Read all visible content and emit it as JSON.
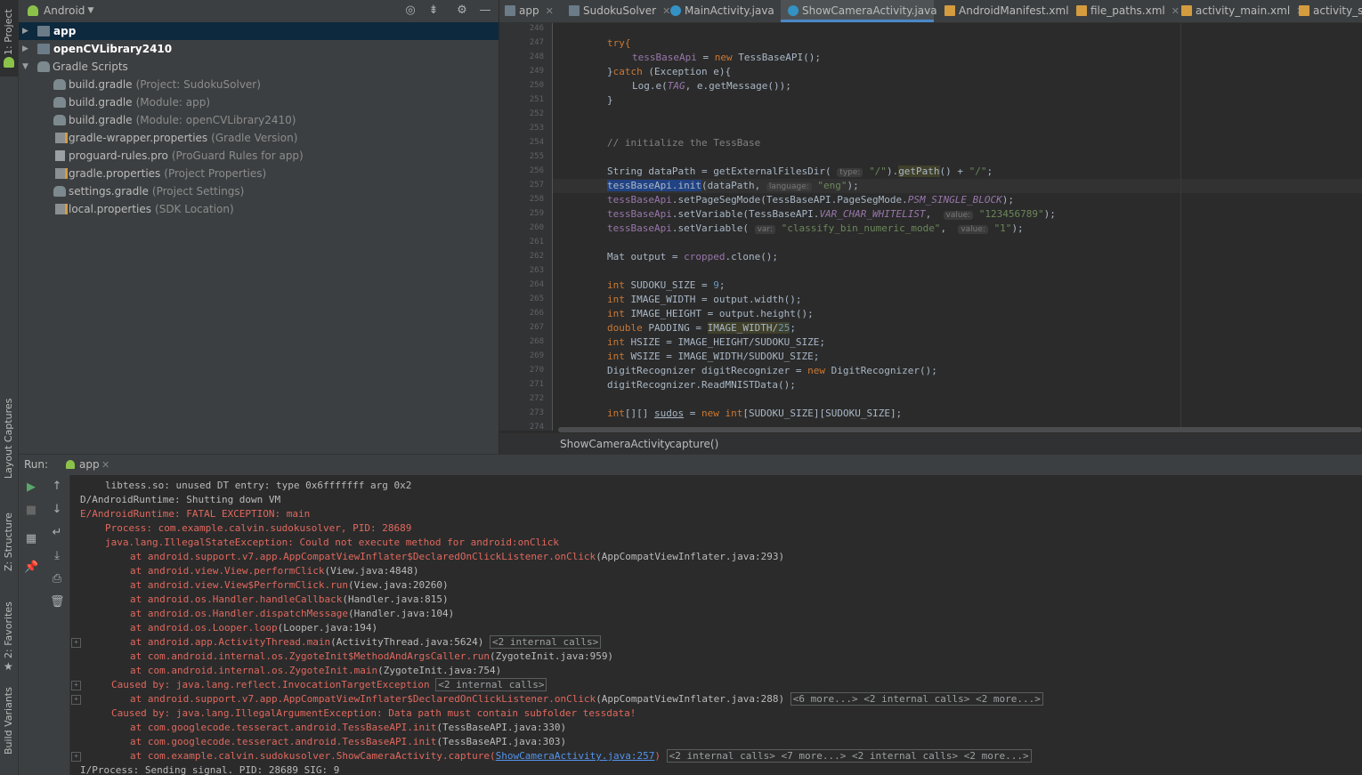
{
  "left_strip": {
    "tabs": [
      {
        "label": "1: Project"
      },
      {
        "label": "Layout Captures"
      },
      {
        "label": "Z: Structure"
      },
      {
        "label": "2: Favorites"
      },
      {
        "label": "Build Variants"
      }
    ]
  },
  "project": {
    "view_mode": "Android",
    "tree": [
      {
        "name": "app",
        "hint": ""
      },
      {
        "name": "openCVLibrary2410",
        "hint": ""
      },
      {
        "name": "Gradle Scripts",
        "hint": ""
      },
      {
        "name": "build.gradle",
        "hint": "(Project: SudokuSolver)"
      },
      {
        "name": "build.gradle",
        "hint": "(Module: app)"
      },
      {
        "name": "build.gradle",
        "hint": "(Module: openCVLibrary2410)"
      },
      {
        "name": "gradle-wrapper.properties",
        "hint": "(Gradle Version)"
      },
      {
        "name": "proguard-rules.pro",
        "hint": "(ProGuard Rules for app)"
      },
      {
        "name": "gradle.properties",
        "hint": "(Project Properties)"
      },
      {
        "name": "settings.gradle",
        "hint": "(Project Settings)"
      },
      {
        "name": "local.properties",
        "hint": "(SDK Location)"
      }
    ]
  },
  "editor": {
    "tabs": [
      {
        "label": "app"
      },
      {
        "label": "SudokuSolver"
      },
      {
        "label": "MainActivity.java"
      },
      {
        "label": "ShowCameraActivity.java"
      },
      {
        "label": "AndroidManifest.xml"
      },
      {
        "label": "file_paths.xml"
      },
      {
        "label": "activity_main.xml"
      },
      {
        "label": "activity_sho"
      }
    ],
    "line_numbers": [
      "246",
      "247",
      "248",
      "249",
      "250",
      "251",
      "252",
      "253",
      "254",
      "255",
      "256",
      "257",
      "258",
      "259",
      "260",
      "261",
      "262",
      "263",
      "264",
      "265",
      "266",
      "267",
      "268",
      "269",
      "270",
      "271",
      "272",
      "273",
      "274"
    ],
    "code": {
      "l247_try": "try{",
      "l248_var": "tessBaseApi",
      "l248_eq": " = ",
      "l248_new": "new",
      "l248_rest": " TessBaseAPI();",
      "l249_brace": "}",
      "l249_catch": "catch",
      "l249_rest": " (Exception e){",
      "l250_a": "Log.e(",
      "l250_tag": "TAG",
      "l250_b": ", e.getMessage());",
      "l251": "}",
      "l254": "// initialize the TessBase",
      "l256_a": "String dataPath = getExternalFilesDir(",
      "l256_hint": "type:",
      "l256_str": "\"/\"",
      "l256_b": ").",
      "l256_getpath": "getPath",
      "l256_c": "() + ",
      "l256_str2": "\"/\"",
      "l256_d": ";",
      "l257_sel": "tessBaseApi.init",
      "l257_a": "(dataPath,",
      "l257_hint": "language:",
      "l257_str": "\"eng\"",
      "l257_b": ");",
      "l258_var": "tessBaseApi",
      "l258_a": ".setPageSegMode(TessBaseAPI.PageSegMode.",
      "l258_const": "PSM_SINGLE_BLOCK",
      "l258_b": ");",
      "l259_var": "tessBaseApi",
      "l259_a": ".setVariable(TessBaseAPI.",
      "l259_const": "VAR_CHAR_WHITELIST",
      "l259_b": ",",
      "l259_hint": "value:",
      "l259_str": "\"123456789\"",
      "l259_c": ");",
      "l260_var": "tessBaseApi",
      "l260_a": ".setVariable(",
      "l260_hint": "var:",
      "l260_str": "\"classify_bin_numeric_mode\"",
      "l260_b": ",",
      "l260_hint2": "value:",
      "l260_str2": "\"1\"",
      "l260_c": ");",
      "l262_a": "Mat output = ",
      "l262_fld": "cropped",
      "l262_b": ".clone();",
      "l264_kw": "int",
      "l264_a": " SUDOKU_SIZE = ",
      "l264_num": "9",
      "l264_b": ";",
      "l265_kw": "int",
      "l265_a": " IMAGE_WIDTH = output.width();",
      "l266_kw": "int",
      "l266_a": " IMAGE_HEIGHT = output.height();",
      "l267_kw": "double",
      "l267_a": " PADDING = ",
      "l267_hl": "IMAGE_WIDTH/",
      "l267_num": "25",
      "l267_b": ";",
      "l268_kw": "int",
      "l268_a": " HSIZE = IMAGE_HEIGHT/SUDOKU_SIZE;",
      "l269_kw": "int",
      "l269_a": " WSIZE = IMAGE_WIDTH/SUDOKU_SIZE;",
      "l270_a": "DigitRecognizer digitRecognizer = ",
      "l270_kw": "new",
      "l270_b": " DigitRecognizer();",
      "l271": "digitRecognizer.ReadMNISTData();",
      "l273_kw": "int",
      "l273_a": "[][] ",
      "l273_u": "sudos",
      "l273_b": " = ",
      "l273_new": "new",
      "l273_kw2": " int",
      "l273_c": "[SUDOKU_SIZE][SUDOKU_SIZE];"
    },
    "breadcrumb": [
      "ShowCameraActivity",
      "capture()"
    ]
  },
  "run": {
    "label": "Run:",
    "tab": "app",
    "console": {
      "c1": "libtess.so: unused DT entry: type 0x6fffffff arg 0x2",
      "c2": "D/AndroidRuntime: Shutting down VM",
      "c3": "E/AndroidRuntime: FATAL EXCEPTION: main",
      "c4": "Process: com.example.calvin.sudokusolver, PID: 28689",
      "c5": "java.lang.IllegalStateException: Could not execute method for android:onClick",
      "c6a": "at android.support.v7.app.AppCompatViewInflater$DeclaredOnClickListener.onClick",
      "c6b": "(AppCompatViewInflater.java:293)",
      "c7a": "at android.view.View.performClick",
      "c7b": "(View.java:4848)",
      "c8a": "at android.view.View$PerformClick.run",
      "c8b": "(View.java:20260)",
      "c9a": "at android.os.Handler.handleCallback",
      "c9b": "(Handler.java:815)",
      "c10a": "at android.os.Handler.dispatchMessage",
      "c10b": "(Handler.java:104)",
      "c11a": "at android.os.Looper.loop",
      "c11b": "(Looper.java:194)",
      "c12a": "at android.app.ActivityThread.main",
      "c12b": "(ActivityThread.java:5624)",
      "c12chip": "<2 internal calls>",
      "c13a": "at com.android.internal.os.ZygoteInit$MethodAndArgsCaller.run",
      "c13b": "(ZygoteInit.java:959)",
      "c14a": "at com.android.internal.os.ZygoteInit.main",
      "c14b": "(ZygoteInit.java:754)",
      "c15a": "Caused by: java.lang.reflect.InvocationTargetException",
      "c15chip": "<2 internal calls>",
      "c16a": "at android.support.v7.app.AppCompatViewInflater$DeclaredOnClickListener.onClick",
      "c16b": "(AppCompatViewInflater.java:288)",
      "c16chip": "<6 more...> <2 internal calls> <2 more...>",
      "c17": "Caused by: java.lang.IllegalArgumentException: Data path must contain subfolder tessdata!",
      "c18a": "at com.googlecode.tesseract.android.TessBaseAPI.init",
      "c18b": "(TessBaseAPI.java:330)",
      "c19a": "at com.googlecode.tesseract.android.TessBaseAPI.init",
      "c19b": "(TessBaseAPI.java:303)",
      "c20a": "at com.example.calvin.sudokusolver.ShowCameraActivity.capture",
      "c20p": "(",
      "c20link": "ShowCameraActivity.java:257",
      "c20q": ")",
      "c20chip": "<2 internal calls> <7 more...> <2 internal calls> <2 more...>",
      "c21": "I/Process: Sending signal. PID: 28689 SIG: 9"
    }
  },
  "colors": {
    "accent": "#4a88c7",
    "error": "#e0685e",
    "keyword": "#cc7832",
    "string": "#6a8759",
    "field": "#9876aa"
  }
}
